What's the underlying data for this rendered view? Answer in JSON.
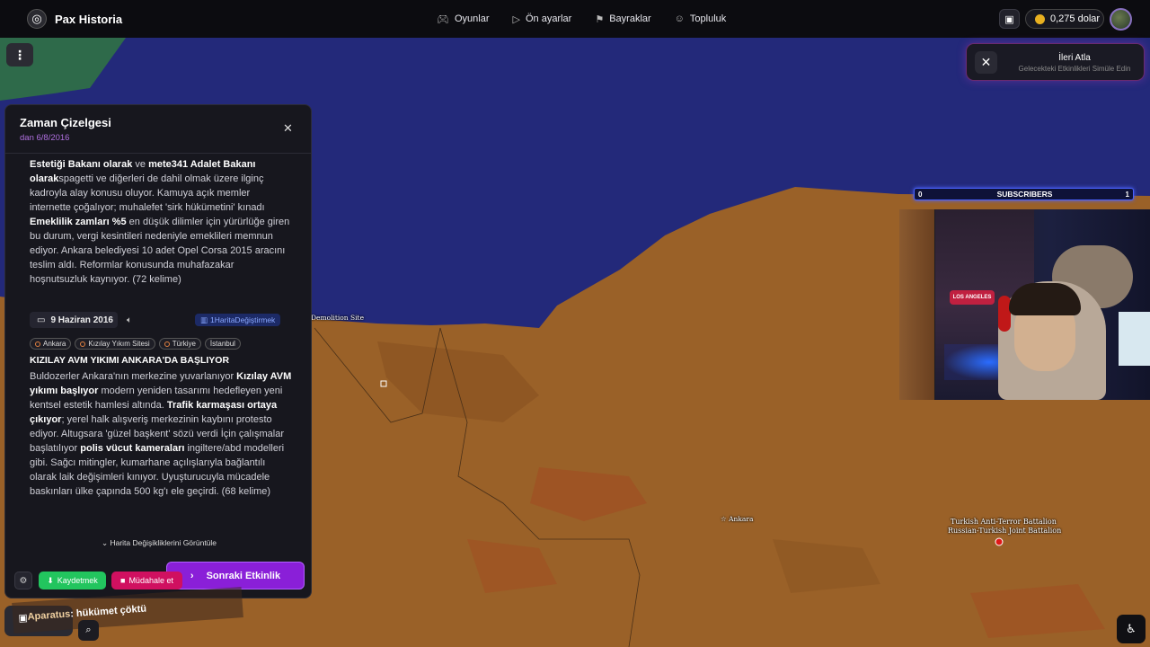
{
  "app": {
    "name": "Pax Historia"
  },
  "nav": [
    {
      "label": "Oyunlar",
      "icon": "gamepad-icon"
    },
    {
      "label": "Ön ayarlar",
      "icon": "play-icon"
    },
    {
      "label": "Bayraklar",
      "icon": "flag-icon"
    },
    {
      "label": "Topluluk",
      "icon": "users-icon"
    }
  ],
  "wallet": {
    "amount": "0,275 dolar"
  },
  "skip": {
    "title": "İleri Atla",
    "subtitle": "Gelecekteki Etkinlikleri Simüle Edin"
  },
  "timeline": {
    "title": "Zaman Çizelgesi",
    "date": "dan 6/8/2016",
    "event1": {
      "lead": "Estetiği Bakanı olarak",
      "t1": " ve ",
      "b1": "mete341 Adalet Bakanı olarak",
      "t2": "spagetti ve diğerleri de dahil olmak üzere ilginç kadroyla alay konusu oluyor. Kamuya açık memler internette çoğalıyor; muhalefet 'sirk hükümetini' kınadı ",
      "b2": "Emeklilik zamları %5",
      "t3": " en düşük dilimler için yürürlüğe giren bu durum, vergi kesintileri nedeniyle emeklileri memnun ediyor. Ankara belediyesi 10 adet Opel Corsa 2015 aracını teslim aldı. Reformlar konusunda muhafazakar hoşnutsuzluk kaynıyor. (72 kelime)"
    },
    "event2": {
      "date": "9 Haziran 2016",
      "map_change": "1HaritaDeğiştirmek",
      "tags": [
        "Ankara",
        "Kızılay Yıkım Sitesi",
        "Türkiye",
        "İstanbul"
      ],
      "headline": "KIZILAY AVM YIKIMI ANKARA'DA BAŞLIYOR",
      "t1": "Buldozerler Ankara'nın merkezine yuvarlanıyor ",
      "b1": "Kızılay AVM yıkımı başlıyor",
      "t2": " modern yeniden tasarımı hedefleyen yeni kentsel estetik hamlesi altında. ",
      "b2": "Trafik karmaşası ortaya çıkıyor",
      "t3": "; yerel halk alışveriş merkezinin kaybını protesto ediyor. Altugsara 'güzel başkent' sözü verdi İçin çalışmalar başlatılıyor ",
      "b3": "polis vücut kameraları",
      "t4": " ingiltere/abd modelleri gibi. Sağcı mitingler, kumarhane açılışlarıyla bağlantılı olarak laik değişimleri kınıyor. Uyuşturucuyla mücadele baskınları ülke çapında 500 kg'ı ele geçirdi. (68 kelime)"
    },
    "view_changes": "Harita Değişikliklerini Görüntüle",
    "save": "Kaydetmek",
    "intervene": "Müdahale et",
    "next": "Sonraki Etkinlik"
  },
  "toast": {
    "prefix": "Aparatus",
    "text": " : hükümet çöktü"
  },
  "subscribers": {
    "left": "0",
    "title": "SUBSCRIBERS",
    "right": "1"
  },
  "webcam": {
    "sign": "LOS ANGELES"
  },
  "map_labels": {
    "ankara": "Ankara",
    "site": "Demolition Site",
    "battalion1": "Turkish Anti-Terror Battalion",
    "battalion2": "Russian-Turkish Joint Battalion"
  },
  "colors": {
    "sea": "#23297a",
    "land": "#9a6128",
    "accent": "#8a1fd8",
    "save": "#22c55e",
    "intervene": "#d01060"
  }
}
